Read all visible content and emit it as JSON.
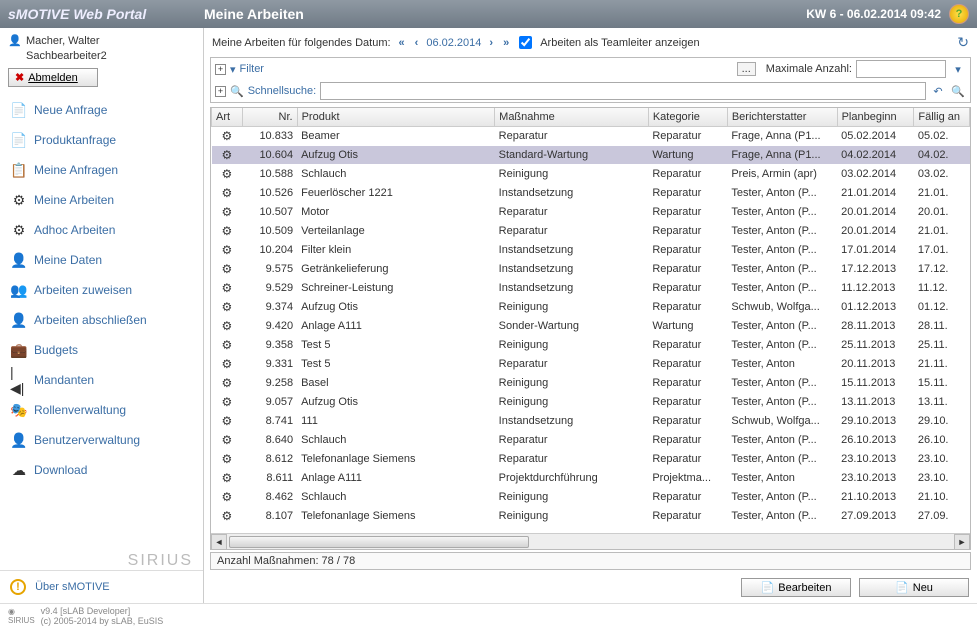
{
  "brand": "sMOTIVE Web Portal",
  "page_title": "Meine Arbeiten",
  "header_date": "KW 6 - 06.02.2014 09:42",
  "user": {
    "name": "Macher, Walter",
    "role": "Sachbearbeiter2",
    "logout_label": "Abmelden"
  },
  "nav": [
    {
      "label": "Neue Anfrage",
      "icon": "📄"
    },
    {
      "label": "Produktanfrage",
      "icon": "📄"
    },
    {
      "label": "Meine Anfragen",
      "icon": "📋"
    },
    {
      "label": "Meine Arbeiten",
      "icon": "⚙"
    },
    {
      "label": "Adhoc Arbeiten",
      "icon": "⚙"
    },
    {
      "label": "Meine Daten",
      "icon": "👤"
    },
    {
      "label": "Arbeiten zuweisen",
      "icon": "👥"
    },
    {
      "label": "Arbeiten abschließen",
      "icon": "👤"
    },
    {
      "label": "Budgets",
      "icon": "💼"
    },
    {
      "label": "Mandanten",
      "icon": "|◀|"
    },
    {
      "label": "Rollenverwaltung",
      "icon": "🎭"
    },
    {
      "label": "Benutzerverwaltung",
      "icon": "👤"
    },
    {
      "label": "Download",
      "icon": "☁"
    }
  ],
  "about_label": "Über sMOTIVE",
  "sirius_label": "SIRIUS",
  "datebar": {
    "prefix": "Meine Arbeiten für folgendes Datum:",
    "date": "06.02.2014",
    "teamleader_label": "Arbeiten als Teamleiter anzeigen"
  },
  "filter": {
    "filter_label": "Filter",
    "max_label": "Maximale Anzahl:",
    "quicksearch_label": "Schnellsuche:"
  },
  "columns": [
    "Art",
    "Nr.",
    "Produkt",
    "Maßnahme",
    "Kategorie",
    "Berichterstatter",
    "Planbeginn",
    "Fällig an"
  ],
  "rows": [
    {
      "nr": "10.833",
      "produkt": "Beamer",
      "mass": "Reparatur",
      "kat": "Reparatur",
      "ber": "Frage, Anna (P1...",
      "plan": "05.02.2014",
      "fall": "05.02.",
      "sel": false
    },
    {
      "nr": "10.604",
      "produkt": "Aufzug Otis",
      "mass": "Standard-Wartung",
      "kat": "Wartung",
      "ber": "Frage, Anna (P1...",
      "plan": "04.02.2014",
      "fall": "04.02.",
      "sel": true
    },
    {
      "nr": "10.588",
      "produkt": "Schlauch",
      "mass": "Reinigung",
      "kat": "Reparatur",
      "ber": "Preis, Armin (apr)",
      "plan": "03.02.2014",
      "fall": "03.02.",
      "sel": false
    },
    {
      "nr": "10.526",
      "produkt": "Feuerlöscher 1221",
      "mass": "Instandsetzung",
      "kat": "Reparatur",
      "ber": "Tester, Anton (P...",
      "plan": "21.01.2014",
      "fall": "21.01.",
      "sel": false
    },
    {
      "nr": "10.507",
      "produkt": "Motor",
      "mass": "Reparatur",
      "kat": "Reparatur",
      "ber": "Tester, Anton (P...",
      "plan": "20.01.2014",
      "fall": "20.01.",
      "sel": false
    },
    {
      "nr": "10.509",
      "produkt": "Verteilanlage",
      "mass": "Reparatur",
      "kat": "Reparatur",
      "ber": "Tester, Anton (P...",
      "plan": "20.01.2014",
      "fall": "21.01.",
      "sel": false
    },
    {
      "nr": "10.204",
      "produkt": "Filter klein",
      "mass": "Instandsetzung",
      "kat": "Reparatur",
      "ber": "Tester, Anton (P...",
      "plan": "17.01.2014",
      "fall": "17.01.",
      "sel": false
    },
    {
      "nr": "9.575",
      "produkt": "Getränkelieferung",
      "mass": "Instandsetzung",
      "kat": "Reparatur",
      "ber": "Tester, Anton (P...",
      "plan": "17.12.2013",
      "fall": "17.12.",
      "sel": false
    },
    {
      "nr": "9.529",
      "produkt": "Schreiner-Leistung",
      "mass": "Instandsetzung",
      "kat": "Reparatur",
      "ber": "Tester, Anton (P...",
      "plan": "11.12.2013",
      "fall": "11.12.",
      "sel": false
    },
    {
      "nr": "9.374",
      "produkt": "Aufzug Otis",
      "mass": "Reinigung",
      "kat": "Reparatur",
      "ber": "Schwub, Wolfga...",
      "plan": "01.12.2013",
      "fall": "01.12.",
      "sel": false
    },
    {
      "nr": "9.420",
      "produkt": "Anlage A111",
      "mass": "Sonder-Wartung",
      "kat": "Wartung",
      "ber": "Tester, Anton (P...",
      "plan": "28.11.2013",
      "fall": "28.11.",
      "sel": false
    },
    {
      "nr": "9.358",
      "produkt": "Test 5",
      "mass": "Reinigung",
      "kat": "Reparatur",
      "ber": "Tester, Anton (P...",
      "plan": "25.11.2013",
      "fall": "25.11.",
      "sel": false
    },
    {
      "nr": "9.331",
      "produkt": "Test 5",
      "mass": "Reparatur",
      "kat": "Reparatur",
      "ber": "Tester, Anton",
      "plan": "20.11.2013",
      "fall": "21.11.",
      "sel": false
    },
    {
      "nr": "9.258",
      "produkt": "Basel",
      "mass": "Reinigung",
      "kat": "Reparatur",
      "ber": "Tester, Anton (P...",
      "plan": "15.11.2013",
      "fall": "15.11.",
      "sel": false
    },
    {
      "nr": "9.057",
      "produkt": "Aufzug Otis",
      "mass": "Reinigung",
      "kat": "Reparatur",
      "ber": "Tester, Anton (P...",
      "plan": "13.11.2013",
      "fall": "13.11.",
      "sel": false
    },
    {
      "nr": "8.741",
      "produkt": "111",
      "mass": "Instandsetzung",
      "kat": "Reparatur",
      "ber": "Schwub, Wolfga...",
      "plan": "29.10.2013",
      "fall": "29.10.",
      "sel": false
    },
    {
      "nr": "8.640",
      "produkt": "Schlauch",
      "mass": "Reparatur",
      "kat": "Reparatur",
      "ber": "Tester, Anton (P...",
      "plan": "26.10.2013",
      "fall": "26.10.",
      "sel": false
    },
    {
      "nr": "8.612",
      "produkt": "Telefonanlage Siemens",
      "mass": "Reparatur",
      "kat": "Reparatur",
      "ber": "Tester, Anton (P...",
      "plan": "23.10.2013",
      "fall": "23.10.",
      "sel": false
    },
    {
      "nr": "8.611",
      "produkt": "Anlage A111",
      "mass": "Projektdurchführung",
      "kat": "Projektma...",
      "ber": "Tester, Anton",
      "plan": "23.10.2013",
      "fall": "23.10.",
      "sel": false
    },
    {
      "nr": "8.462",
      "produkt": "Schlauch",
      "mass": "Reinigung",
      "kat": "Reparatur",
      "ber": "Tester, Anton (P...",
      "plan": "21.10.2013",
      "fall": "21.10.",
      "sel": false
    },
    {
      "nr": "8.107",
      "produkt": "Telefonanlage Siemens",
      "mass": "Reinigung",
      "kat": "Reparatur",
      "ber": "Tester, Anton (P...",
      "plan": "27.09.2013",
      "fall": "27.09.",
      "sel": false
    }
  ],
  "count_label": "Anzahl Maßnahmen: 78 / 78",
  "actions": {
    "edit": "Bearbeiten",
    "new": "Neu"
  },
  "footer": {
    "version": "v9.4 [sLAB Developer]",
    "copyright": "(c) 2005-2014 by sLAB, EuSIS"
  }
}
